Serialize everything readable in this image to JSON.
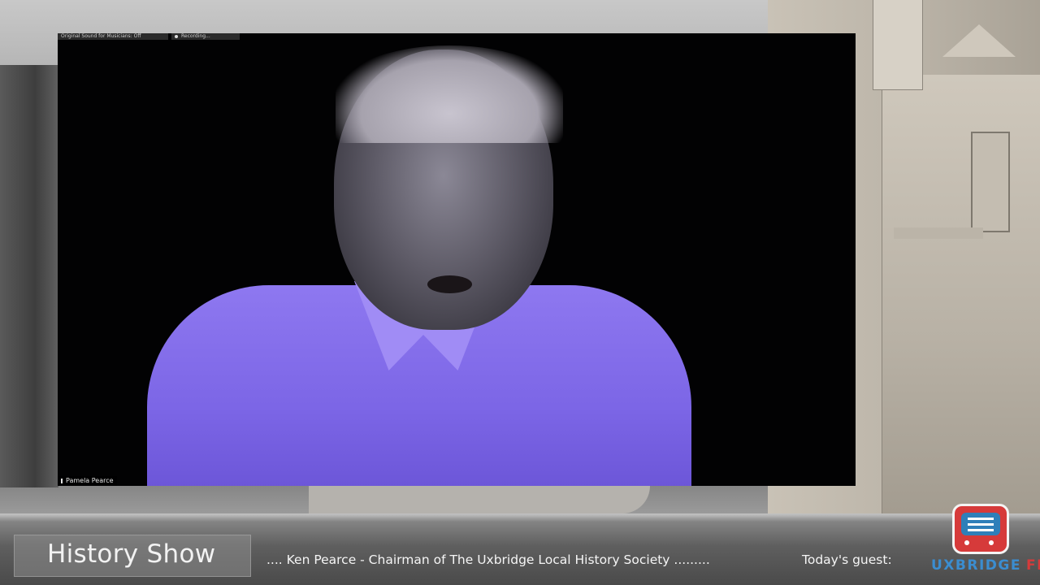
{
  "video_call": {
    "top_badges": {
      "sound": "Original Sound for Musicians: Off",
      "recording": "Recording..."
    },
    "participant_name": "Pamela Pearce"
  },
  "lower_third": {
    "show_title": "History Show",
    "ticker_text": ".... Ken Pearce - Chairman of The Uxbridge Local History Society  .........",
    "guest_label": "Today's guest:"
  },
  "logo": {
    "icon": "radio-icon",
    "word": "UXBRIDGE",
    "suffix": "FM",
    "colors": {
      "word": "#3b8dd0",
      "suffix": "#d63a3a",
      "radio_body": "#d63a3a",
      "radio_grill": "#2f7fb9"
    }
  }
}
